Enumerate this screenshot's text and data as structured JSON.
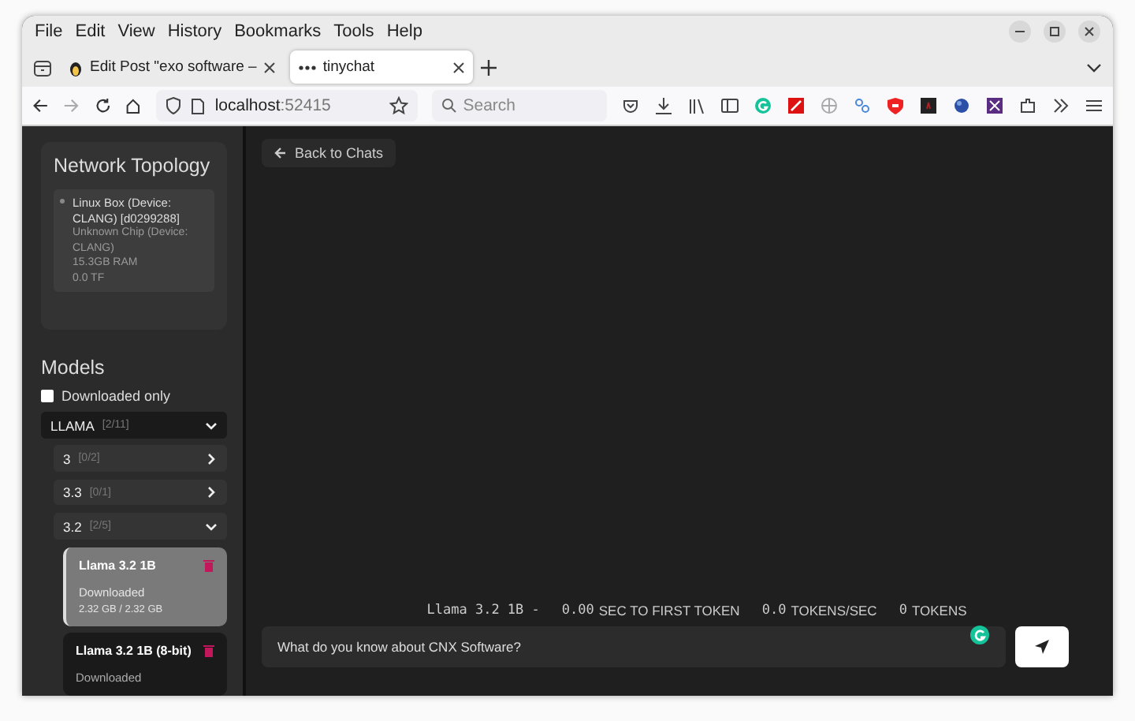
{
  "menu": [
    "File",
    "Edit",
    "View",
    "History",
    "Bookmarks",
    "Tools",
    "Help"
  ],
  "tabs": [
    {
      "title": "Edit Post \"exo software –",
      "selected": false
    },
    {
      "title": "tinychat",
      "selected": true
    }
  ],
  "address": {
    "host": "localhost",
    "port": ":52415"
  },
  "search": {
    "placeholder": "Search"
  },
  "sidebar": {
    "topology": {
      "title": "Network Topology",
      "nodes": [
        {
          "name": "Linux Box (Device: CLANG) [d0299288]",
          "chip": "Unknown Chip (Device: CLANG)",
          "ram": "15.3GB RAM",
          "flops": "0.0 TF"
        }
      ]
    },
    "models_title": "Models",
    "filter": {
      "label": "Downloaded only",
      "checked": false
    },
    "groups": [
      {
        "name": "LLAMA",
        "count": "[2/11]",
        "expanded": true,
        "children": [
          {
            "name": "3",
            "count": "[0/2]",
            "expanded": false
          },
          {
            "name": "3.3",
            "count": "[0/1]",
            "expanded": false
          },
          {
            "name": "3.2",
            "count": "[2/5]",
            "expanded": true,
            "models": [
              {
                "name": "Llama 3.2 1B",
                "status": "Downloaded",
                "size": "2.32 GB / 2.32 GB",
                "selected": true
              },
              {
                "name": "Llama 3.2 1B (8-bit)",
                "status": "Downloaded",
                "selected": false
              }
            ]
          }
        ]
      }
    ]
  },
  "back_button": "Back to Chats",
  "stats": {
    "model": "Llama 3.2 1B -",
    "items": [
      {
        "reading": "0.00",
        "unit": "SEC TO FIRST TOKEN"
      },
      {
        "reading": "0.0",
        "unit": "TOKENS/SEC"
      },
      {
        "reading": "0",
        "unit": "TOKENS"
      }
    ]
  },
  "input": {
    "value": "What do you know about CNX Software?"
  }
}
